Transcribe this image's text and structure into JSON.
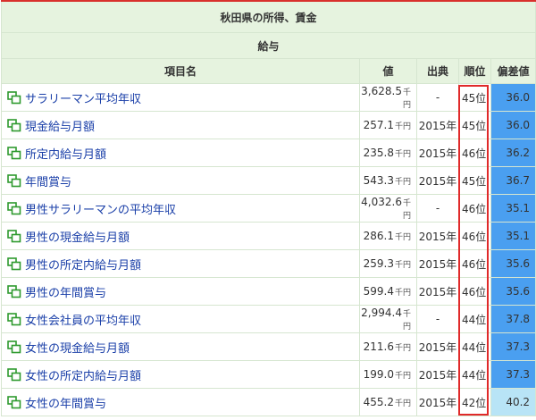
{
  "title": "秋田県の所得、賃金",
  "subtitle": "給与",
  "headers": {
    "item": "項目名",
    "value": "値",
    "source": "出典",
    "rank": "順位",
    "deviation": "偏差値"
  },
  "unit": "千円",
  "colors": {
    "header_bg": "#e6f3df",
    "border": "#d6e6d0",
    "link": "#1a3fa8",
    "accent_red": "#d9302c",
    "dev_blue": "#4a9ff0",
    "dev_light": "#b8e4f6"
  },
  "rows": [
    {
      "name": "サラリーマン平均年収",
      "value": "3,628.5",
      "source": "-",
      "rank": "45位",
      "deviation": "36.0",
      "dev_color": "#4a9ff0"
    },
    {
      "name": "現金給与月額",
      "value": "257.1",
      "source": "2015年",
      "rank": "45位",
      "deviation": "36.0",
      "dev_color": "#4a9ff0"
    },
    {
      "name": "所定内給与月額",
      "value": "235.8",
      "source": "2015年",
      "rank": "46位",
      "deviation": "36.2",
      "dev_color": "#4a9ff0"
    },
    {
      "name": "年間賞与",
      "value": "543.3",
      "source": "2015年",
      "rank": "45位",
      "deviation": "36.7",
      "dev_color": "#4a9ff0"
    },
    {
      "name": "男性サラリーマンの平均年収",
      "value": "4,032.6",
      "source": "-",
      "rank": "46位",
      "deviation": "35.1",
      "dev_color": "#4a9ff0"
    },
    {
      "name": "男性の現金給与月額",
      "value": "286.1",
      "source": "2015年",
      "rank": "46位",
      "deviation": "35.1",
      "dev_color": "#4a9ff0"
    },
    {
      "name": "男性の所定内給与月額",
      "value": "259.3",
      "source": "2015年",
      "rank": "46位",
      "deviation": "35.6",
      "dev_color": "#4a9ff0"
    },
    {
      "name": "男性の年間賞与",
      "value": "599.4",
      "source": "2015年",
      "rank": "46位",
      "deviation": "35.6",
      "dev_color": "#4a9ff0"
    },
    {
      "name": "女性会社員の平均年収",
      "value": "2,994.4",
      "source": "-",
      "rank": "44位",
      "deviation": "37.8",
      "dev_color": "#4a9ff0"
    },
    {
      "name": "女性の現金給与月額",
      "value": "211.6",
      "source": "2015年",
      "rank": "44位",
      "deviation": "37.3",
      "dev_color": "#4a9ff0"
    },
    {
      "name": "女性の所定内給与月額",
      "value": "199.0",
      "source": "2015年",
      "rank": "44位",
      "deviation": "37.3",
      "dev_color": "#4a9ff0"
    },
    {
      "name": "女性の年間賞与",
      "value": "455.2",
      "source": "2015年",
      "rank": "42位",
      "deviation": "40.2",
      "dev_color": "#b8e4f6"
    }
  ]
}
